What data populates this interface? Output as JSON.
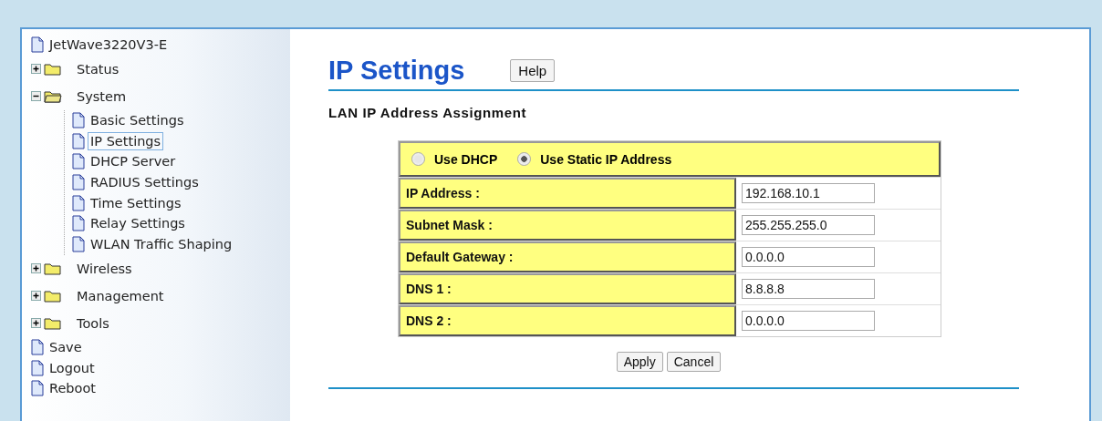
{
  "sidebar": {
    "items": [
      {
        "kind": "file",
        "label": "JetWave3220V3-E",
        "selected": false
      },
      {
        "kind": "folder",
        "label": "Status",
        "expanded": false
      },
      {
        "kind": "folder",
        "label": "System",
        "expanded": true,
        "children": [
          {
            "kind": "file",
            "label": "Basic Settings",
            "selected": false
          },
          {
            "kind": "file",
            "label": "IP Settings",
            "selected": true
          },
          {
            "kind": "file",
            "label": "DHCP Server",
            "selected": false
          },
          {
            "kind": "file",
            "label": "RADIUS Settings",
            "selected": false
          },
          {
            "kind": "file",
            "label": "Time Settings",
            "selected": false
          },
          {
            "kind": "file",
            "label": "Relay Settings",
            "selected": false
          },
          {
            "kind": "file",
            "label": "WLAN Traffic Shaping",
            "selected": false
          }
        ]
      },
      {
        "kind": "folder",
        "label": "Wireless",
        "expanded": false
      },
      {
        "kind": "folder",
        "label": "Management",
        "expanded": false
      },
      {
        "kind": "folder",
        "label": "Tools",
        "expanded": false
      },
      {
        "kind": "file",
        "label": "Save",
        "selected": false
      },
      {
        "kind": "file",
        "label": "Logout",
        "selected": false
      },
      {
        "kind": "file",
        "label": "Reboot",
        "selected": false
      }
    ]
  },
  "page": {
    "title": "IP Settings",
    "help_button": "Help",
    "section_title": "LAN IP Address Assignment"
  },
  "mode": [
    {
      "label": "Use DHCP",
      "selected": false
    },
    {
      "label": "Use Static IP Address",
      "selected": true
    }
  ],
  "fields": [
    {
      "label": "IP Address :",
      "value": "192.168.10.1"
    },
    {
      "label": "Subnet Mask :",
      "value": "255.255.255.0"
    },
    {
      "label": "Default Gateway :",
      "value": "0.0.0.0"
    },
    {
      "label": "DNS 1 :",
      "value": "8.8.8.8"
    },
    {
      "label": "DNS 2 :",
      "value": "0.0.0.0"
    }
  ],
  "buttons": [
    "Apply",
    "Cancel"
  ]
}
